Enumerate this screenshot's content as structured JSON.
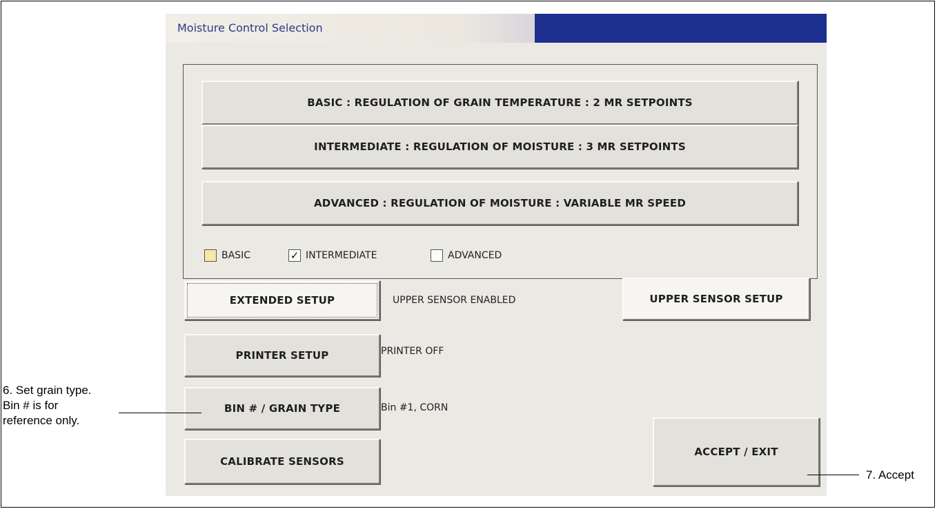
{
  "window": {
    "title": "Moisture Control Selection"
  },
  "modes": {
    "basic_button": "BASIC : REGULATION OF GRAIN TEMPERATURE : 2 MR SETPOINTS",
    "intermediate_button": "INTERMEDIATE : REGULATION OF MOISTURE : 3 MR SETPOINTS",
    "advanced_button": "ADVANCED : REGULATION OF MOISTURE : VARIABLE MR SPEED"
  },
  "checkboxes": [
    {
      "label": "BASIC",
      "checked": false
    },
    {
      "label": "INTERMEDIATE",
      "checked": true
    },
    {
      "label": "ADVANCED",
      "checked": false
    }
  ],
  "setup": {
    "extended_setup_label": "EXTENDED SETUP",
    "extended_setup_status": "UPPER SENSOR ENABLED",
    "upper_sensor_setup_label": "UPPER SENSOR SETUP",
    "printer_setup_label": "PRINTER SETUP",
    "printer_status": "PRINTER OFF",
    "bin_grain_label": "BIN # / GRAIN TYPE",
    "bin_grain_status": "Bin #1, CORN",
    "calibrate_label": "CALIBRATE SENSORS",
    "accept_exit_label": "ACCEPT / EXIT"
  },
  "callouts": {
    "left_line1": "6. Set grain type.",
    "left_line2": "Bin # is for",
    "left_line3": "reference only.",
    "right": "7. Accept"
  },
  "icons": {
    "checkmark": "✓"
  },
  "colors": {
    "titlebar": "#1d2f8f",
    "panel": "#ebe9e4",
    "basic_checkbox": "#f7e7a8"
  }
}
